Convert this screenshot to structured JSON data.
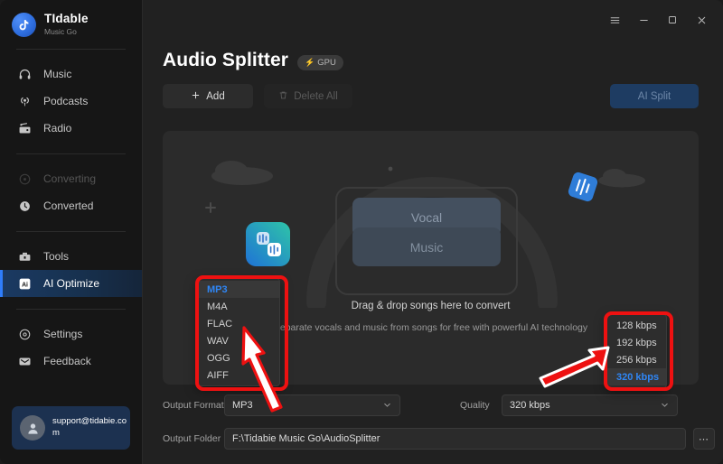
{
  "window": {
    "controls": [
      {
        "name": "menu-button",
        "glyph": "☰"
      },
      {
        "name": "minimize-button",
        "glyph": "–"
      },
      {
        "name": "maximize-button",
        "glyph": "☐"
      },
      {
        "name": "close-button",
        "glyph": "✕"
      }
    ]
  },
  "sidebar": {
    "brand": {
      "name": "TIdable",
      "subtitle": "Music Go"
    },
    "items": [
      {
        "label": "Music",
        "icon": "headphones-icon",
        "state": "normal"
      },
      {
        "label": "Podcasts",
        "icon": "podcast-icon",
        "state": "normal"
      },
      {
        "label": "Radio",
        "icon": "radio-icon",
        "state": "normal"
      },
      {
        "label": "Converting",
        "icon": "converting-icon",
        "state": "disabled"
      },
      {
        "label": "Converted",
        "icon": "clock-icon",
        "state": "normal"
      },
      {
        "label": "Tools",
        "icon": "toolbox-icon",
        "state": "normal"
      },
      {
        "label": "AI Optimize",
        "icon": "ai-icon",
        "state": "active"
      },
      {
        "label": "Settings",
        "icon": "gear-icon",
        "state": "normal"
      },
      {
        "label": "Feedback",
        "icon": "mail-icon",
        "state": "normal"
      }
    ],
    "account": {
      "email": "support@tidabie.com",
      "avatar_icon": "user-avatar-icon"
    }
  },
  "main": {
    "title": "Audio Splitter",
    "badge": {
      "label": "GPU",
      "icon": "lightning-bolt-icon"
    },
    "buttons": {
      "add": "Add",
      "add_icon": "plus-icon",
      "delete_all": "Delete All",
      "delete_icon": "trash-icon",
      "ai_split": "AI Split"
    },
    "dropzone": {
      "caption": "Drag & drop songs here to convert",
      "subtitle": "Separate vocals and music from songs for free with powerful AI technology",
      "art_labels": {
        "vocal": "Vocal",
        "music": "Music"
      }
    },
    "form": {
      "output_format_label": "Output Format",
      "output_format_value": "MP3",
      "quality_label": "Quality",
      "quality_value": "320 kbps",
      "output_folder_label": "Output Folder",
      "output_folder_value": "F:\\Tidabie Music Go\\AudioSplitter",
      "browse_label": "⋯",
      "chevron_icon": "chevron-down-icon"
    },
    "format_menu": {
      "options": [
        "MP3",
        "M4A",
        "FLAC",
        "WAV",
        "OGG",
        "AIFF"
      ],
      "selected": "MP3"
    },
    "quality_menu": {
      "options": [
        "128 kbps",
        "192 kbps",
        "256 kbps",
        "320 kbps"
      ],
      "selected": "320 kbps"
    }
  },
  "annotations": {
    "highlight_color": "#ee1111",
    "boxes": [
      "format-menu-highlight",
      "quality-menu-highlight"
    ],
    "arrows": [
      "arrow-pointing-to-format-menu",
      "arrow-pointing-to-quality-menu"
    ]
  }
}
